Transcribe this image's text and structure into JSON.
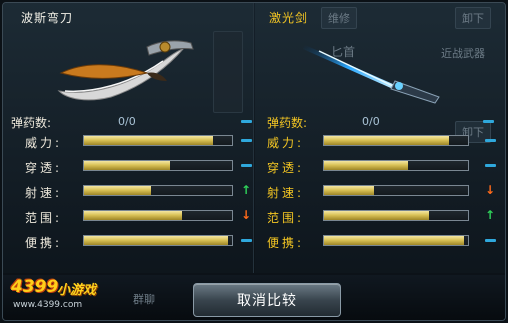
{
  "colors": {
    "bar_fill": "#d9c257",
    "neutral_dash": "#2fa8dc",
    "stat_up": "#2fd25a",
    "stat_down": "#ff6a1a",
    "right_label": "#f4c623"
  },
  "left_weapon": {
    "name": "波斯弯刀",
    "ammo_label": "弹药数:",
    "ammo_value": "0/0",
    "stats": [
      {
        "label": "威力:",
        "fill": 0.87,
        "indicator": "neutral",
        "icon": "dash-icon"
      },
      {
        "label": "穿透:",
        "fill": 0.58,
        "indicator": "neutral",
        "icon": "dash-icon"
      },
      {
        "label": "射速:",
        "fill": 0.45,
        "indicator": "up",
        "icon": "arrow-up-icon"
      },
      {
        "label": "范围:",
        "fill": 0.66,
        "indicator": "down",
        "icon": "arrow-down-icon"
      },
      {
        "label": "便携:",
        "fill": 0.97,
        "indicator": "neutral",
        "icon": "dash-icon"
      }
    ]
  },
  "right_weapon": {
    "name": "激光剑",
    "ammo_label": "弹药数:",
    "ammo_value": "0/0",
    "stats": [
      {
        "label": "威力:",
        "fill": 0.87,
        "indicator": "neutral",
        "icon": "dash-icon"
      },
      {
        "label": "穿透:",
        "fill": 0.58,
        "indicator": "neutral",
        "icon": "dash-icon"
      },
      {
        "label": "射速:",
        "fill": 0.35,
        "indicator": "down",
        "icon": "arrow-down-icon"
      },
      {
        "label": "范围:",
        "fill": 0.73,
        "indicator": "up",
        "icon": "arrow-up-icon"
      },
      {
        "label": "便携:",
        "fill": 0.97,
        "indicator": "neutral",
        "icon": "dash-icon"
      }
    ]
  },
  "background_ui": {
    "repair_tag": "维修",
    "unload_tag_1": "卸下",
    "unload_tag_2": "卸下",
    "dagger_label": "匕首",
    "melee_label": "近战武器",
    "chat_tag": "群聊"
  },
  "compare_button": "取消比较",
  "logo": {
    "number": "4399",
    "text": "小游戏",
    "url": "www.4399.com"
  }
}
